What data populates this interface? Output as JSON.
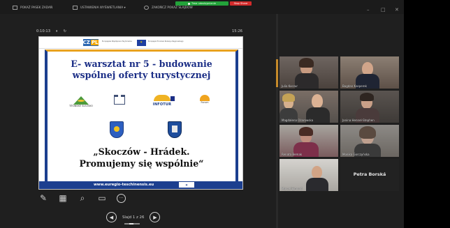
{
  "topbar": {
    "item1": "POKAŻ PASEK ZADAŃ",
    "item2": "USTAWIENIA WYŚWIETLANIA ▾",
    "item3": "ZAKOŃCZ POKAZ SLAJDÓW",
    "sharing": "Trwa udostępnianie",
    "stop": "Stop Share",
    "minimize": "–",
    "maximize": "□",
    "close": "✕"
  },
  "timer": {
    "elapsed": "0:10:13",
    "pause": "⏸",
    "reset": "↻",
    "clock": "15:26"
  },
  "slide": {
    "header_text_left": "Europejska Współpraca Terytorialna",
    "header_text_right": "Europejski Fundusz Rozwoju Regionalnego",
    "title_line1": "E- warsztat nr 5 - budowanie",
    "title_line2": "wspólnej oferty turystycznej",
    "logo1": "TĚŠÍNSKÉ SLEZSKO",
    "logo2": "INFOTUR",
    "logo3": "Forum",
    "quote_line1": "„Skoczów - Hrádek.",
    "quote_line2": "Promujemy się wspólnie“",
    "url": "www.euregio-teschinensis.eu"
  },
  "tools": {
    "pen": "✎",
    "pointer": "▦",
    "zoom": "⌕",
    "screen": "▭",
    "more": "···"
  },
  "nav": {
    "prev": "◀",
    "label": "Slajd 1 z 26",
    "next": "▶"
  },
  "participants": [
    {
      "name": "Julia Koczur"
    },
    {
      "name": "Bogdan Kasperek"
    },
    {
      "name": "Magdalena Ożarowska"
    },
    {
      "name": "Janina Hennel-Stephen"
    },
    {
      "name": "Renata Bemak"
    },
    {
      "name": "Monika Gorczyńska"
    },
    {
      "name": "Marcel Ejmond"
    },
    {
      "name": "Petra Borská"
    }
  ],
  "colors": {
    "slide_blue": "#1b2e86",
    "slide_orange": "#e9a21e",
    "share_green": "#23a33a",
    "stop_red": "#d32a2a"
  }
}
